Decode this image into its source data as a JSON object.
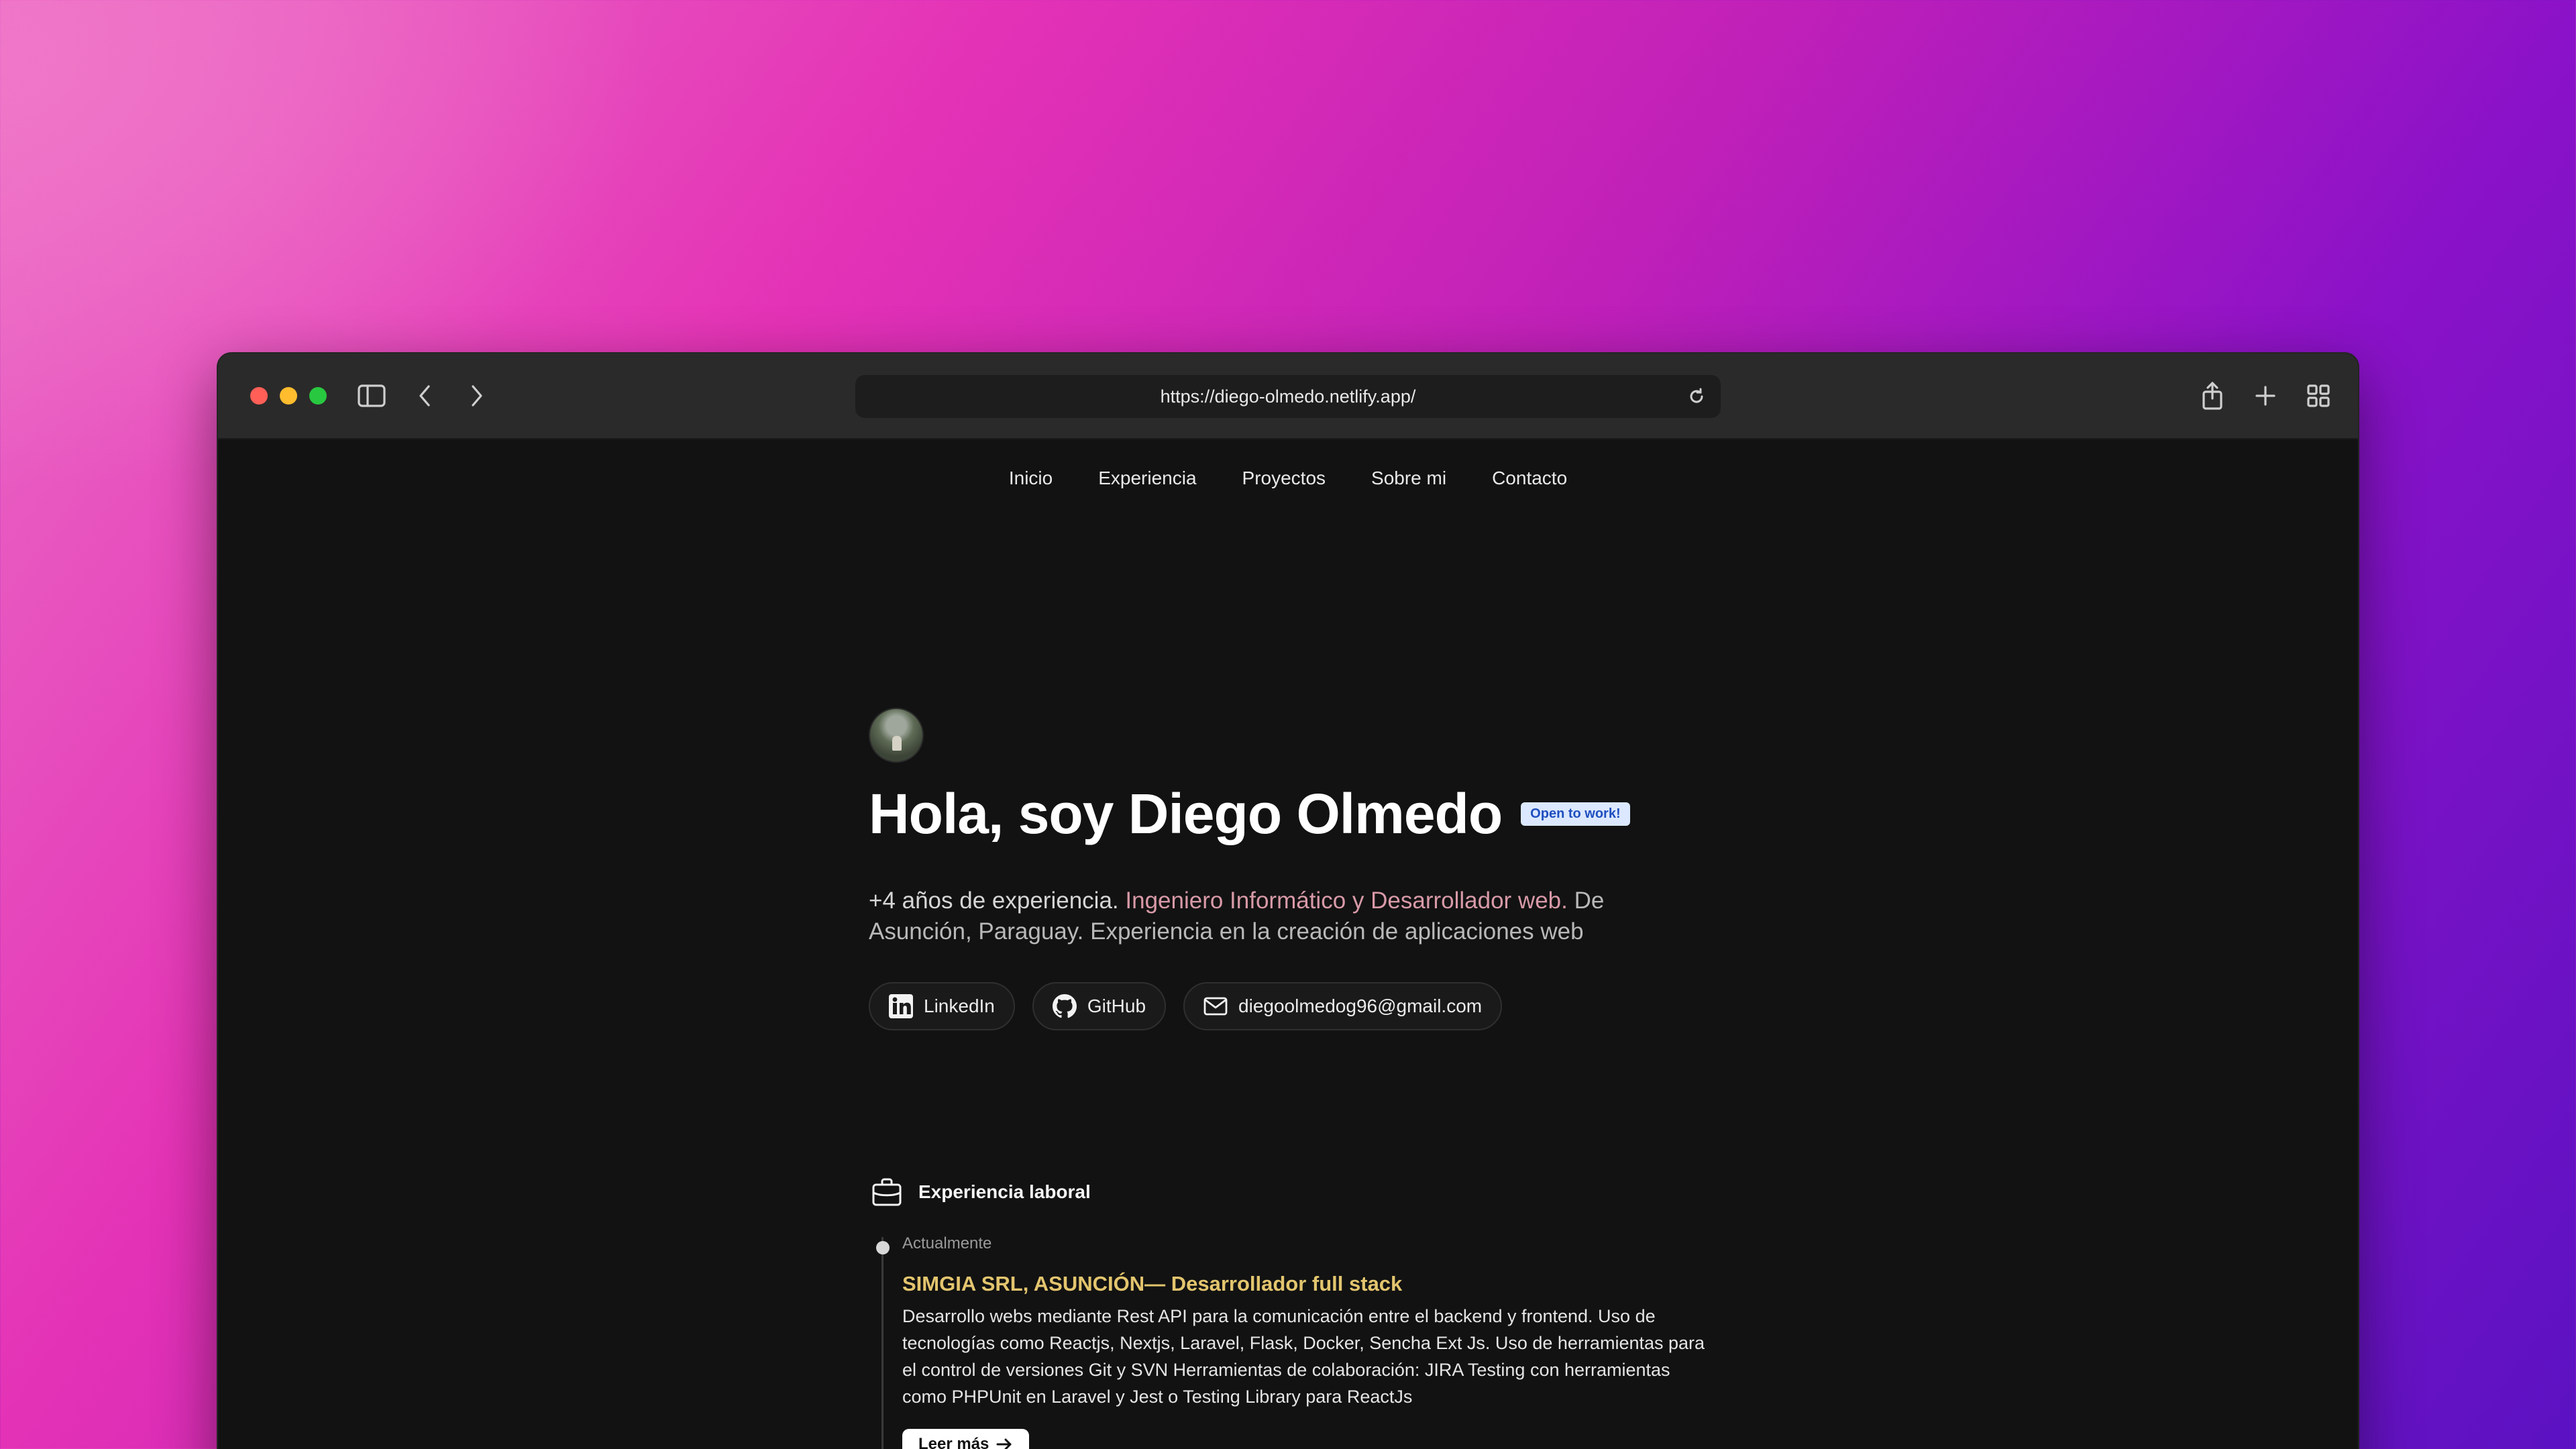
{
  "browser": {
    "url": "https://diego-olmedo.netlify.app/"
  },
  "nav": {
    "items": [
      "Inicio",
      "Experiencia",
      "Proyectos",
      "Sobre mi",
      "Contacto"
    ]
  },
  "hero": {
    "title": "Hola, soy Diego Olmedo",
    "badge": "Open to work!",
    "intro_lead": "+4 años de experiencia.",
    "intro_highlight": "Ingeniero Informático y Desarrollador web.",
    "intro_rest": "De Asunción, Paraguay. Experiencia en la creación de aplicaciones web",
    "links": {
      "linkedin": "LinkedIn",
      "github": "GitHub",
      "email": "diegoolmedog96@gmail.com"
    }
  },
  "experience": {
    "section_title": "Experiencia laboral",
    "items": [
      {
        "date": "Actualmente",
        "role": "SIMGIA SRL, ASUNCIÓN— Desarrollador full stack",
        "description": "Desarrollo webs mediante Rest API para la comunicación entre el backend y frontend. Uso de tecnologías como Reactjs, Nextjs, Laravel, Flask, Docker, Sencha Ext Js. Uso de herramientas para el control de versiones Git y SVN Herramientas de colaboración: JIRA Testing con herramientas como PHPUnit en Laravel y Jest o Testing Library para ReactJs",
        "button": "Leer más"
      }
    ]
  },
  "icons": [
    "sidebar-icon",
    "back-icon",
    "forward-icon",
    "reload-icon",
    "share-icon",
    "new-tab-icon",
    "tab-overview-icon",
    "linkedin-icon",
    "github-icon",
    "mail-icon",
    "briefcase-icon",
    "arrow-right-icon"
  ]
}
